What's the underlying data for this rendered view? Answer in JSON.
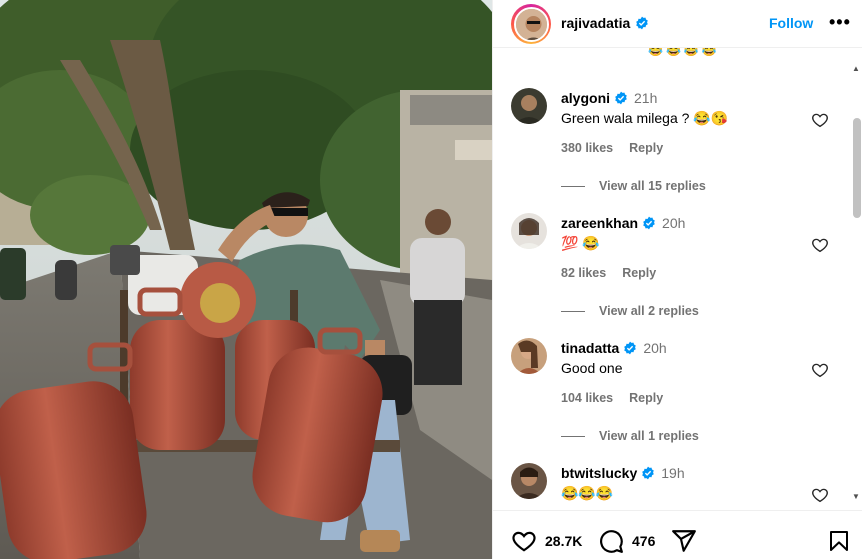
{
  "header": {
    "username": "rajivadatia",
    "follow_label": "Follow",
    "more_label": "•••"
  },
  "emoji_peek": "😂😂😂😂",
  "comments": [
    {
      "username": "alygoni",
      "time": "21h",
      "text": "Green wala milega ? 😂😘",
      "likes": "380 likes",
      "reply_label": "Reply",
      "view_replies": "View all 15 replies"
    },
    {
      "username": "zareenkhan",
      "time": "20h",
      "text": "💯 😂",
      "likes": "82 likes",
      "reply_label": "Reply",
      "view_replies": "View all 2 replies"
    },
    {
      "username": "tinadatta",
      "time": "20h",
      "text": "Good one",
      "likes": "104 likes",
      "reply_label": "Reply",
      "view_replies": "View all 1 replies"
    },
    {
      "username": "btwitslucky",
      "time": "19h",
      "text": "😂😂😂",
      "likes": "",
      "reply_label": "",
      "view_replies": ""
    }
  ],
  "footer": {
    "likes_count": "28.7K",
    "comments_count": "476"
  },
  "colors": {
    "accent": "#0095f6",
    "verified": "#0095f6",
    "muted": "#737373"
  },
  "icons": {
    "header_more": "more-icon",
    "comment_like": "heart-outline-icon",
    "footer_like": "heart-outline-icon",
    "footer_comment": "comment-bubble-icon",
    "footer_share": "paper-plane-icon",
    "footer_save": "bookmark-icon"
  }
}
